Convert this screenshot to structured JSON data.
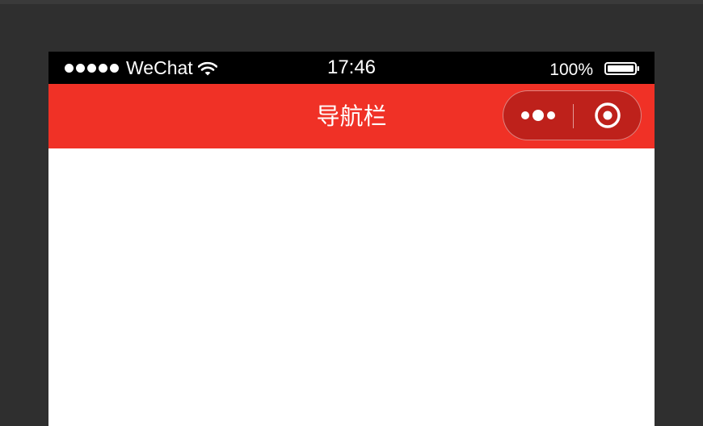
{
  "status_bar": {
    "carrier": "WeChat",
    "time": "17:46",
    "battery_percent": "100%",
    "signal_bars": 5,
    "wifi_icon": "wifi-icon",
    "battery_icon": "battery-icon"
  },
  "nav_bar": {
    "title": "导航栏",
    "background_color": "#f03126",
    "capsule": {
      "more_icon": "more-dots-icon",
      "close_icon": "target-circle-icon"
    }
  },
  "colors": {
    "backdrop": "#2f2f2f",
    "status_bar": "#000000",
    "content": "#ffffff"
  }
}
